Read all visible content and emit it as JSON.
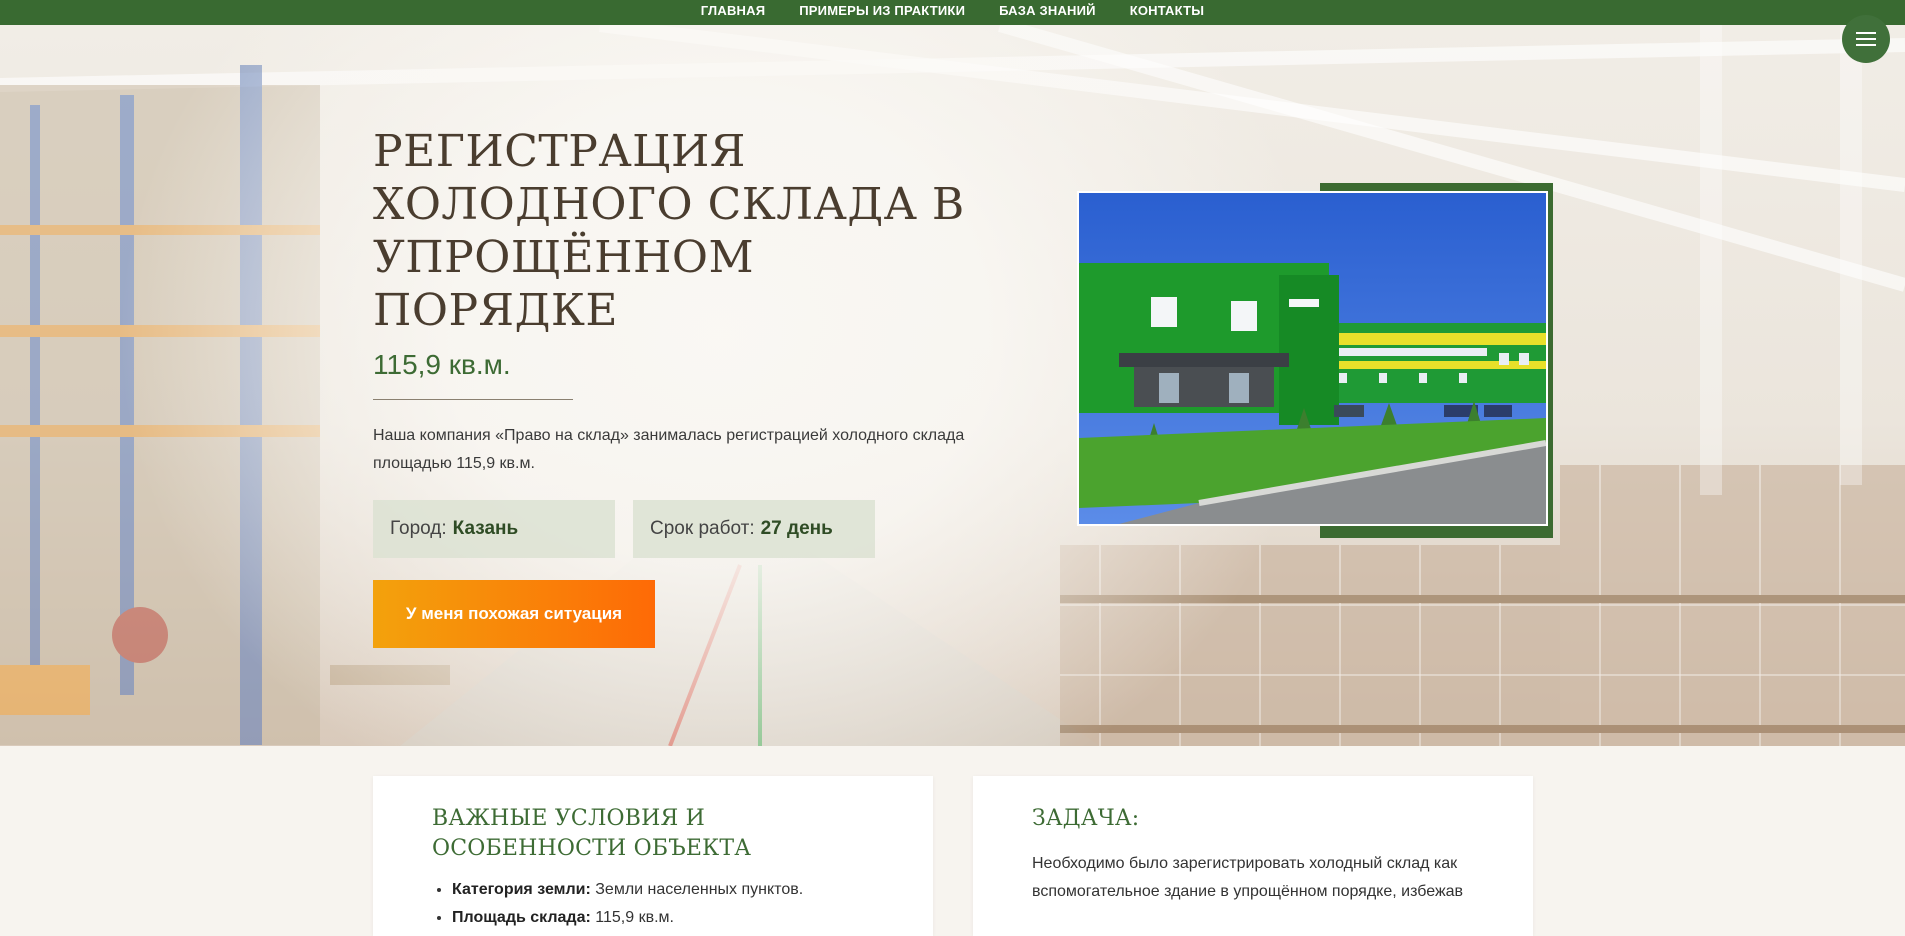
{
  "nav": {
    "items": [
      {
        "label": "ГЛАВНАЯ"
      },
      {
        "label": "ПРИМЕРЫ ИЗ ПРАКТИКИ"
      },
      {
        "label": "БАЗА ЗНАНИЙ"
      },
      {
        "label": "КОНТАКТЫ"
      }
    ],
    "menu_icon": "hamburger-icon"
  },
  "hero": {
    "title": "РЕГИСТРАЦИЯ ХОЛОДНОГО СКЛАДА В УПРОЩЁННОМ ПОРЯДКЕ",
    "area": "115,9 кв.м.",
    "description": "Наша компания «Право на склад» занималась регистрацией холодного склада площадью 115,9 кв.м.",
    "city_label": "Город:",
    "city_value": "Казань",
    "term_label": "Срок работ:",
    "term_value": "27 день",
    "cta_label": "У меня похожая ситуация"
  },
  "cards": {
    "conditions": {
      "title": "ВАЖНЫЕ УСЛОВИЯ И ОСОБЕННОСТИ ОБЪЕКТА",
      "items": [
        {
          "label": "Категория земли:",
          "value": "Земли населенных пунктов."
        },
        {
          "label": "Площадь склада:",
          "value": "115,9 кв.м."
        }
      ]
    },
    "task": {
      "title": "ЗАДАЧА:",
      "text": "Необходимо было зарегистрировать холодный склад как вспомогательное здание в упрощённом порядке, избежав"
    }
  },
  "colors": {
    "brand_green": "#396a31",
    "cta_start": "#f3a20c",
    "cta_end": "#fe6a06"
  }
}
